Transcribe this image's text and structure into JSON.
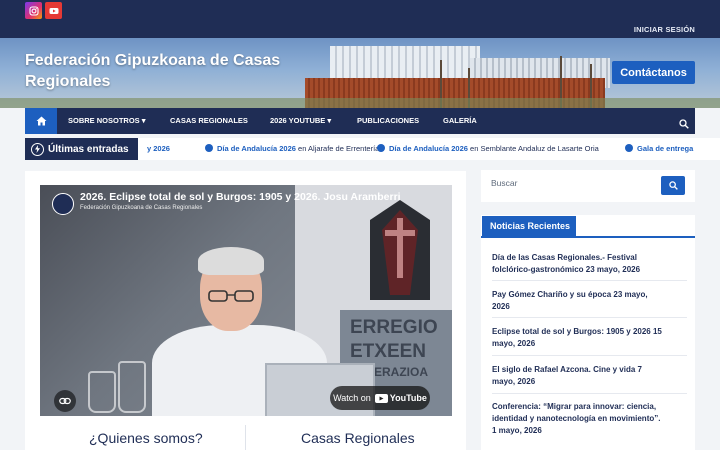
{
  "topbar": {
    "social": [
      {
        "icon": "instagram-icon"
      },
      {
        "icon": "youtube-icon"
      }
    ],
    "login_label": "INICIAR SESIÓN"
  },
  "header": {
    "site_title_line1": "Federación Gipuzkoana de Casas",
    "site_title_line2": "Regionales",
    "contact_button": "Contáctanos"
  },
  "nav": {
    "home_icon": "home-icon",
    "items": [
      {
        "label": "SOBRE NOSOTROS ▾"
      },
      {
        "label": "CASAS REGIONALES"
      },
      {
        "label": "2026 YOUTUBE ▾"
      },
      {
        "label": "PUBLICACIONES"
      },
      {
        "label": "GALERÍA"
      }
    ],
    "search_icon": "search-icon"
  },
  "ticker": {
    "label": "Últimas entradas",
    "items": [
      {
        "text": "y 2026"
      },
      {
        "bold": "Día de Andalucía 2026",
        "text": " en Aljarafe de Errentería"
      },
      {
        "bold": "Día de Andalucía 2026",
        "text": " en Semblante Andaluz de Lasarte Oria"
      },
      {
        "bold": "Gala de entrega",
        "text": ""
      }
    ]
  },
  "video": {
    "title": "2026. Eclipse total de sol y Burgos: 1905 y 2026. Josu Aramberri",
    "channel": "Federación Gipuzkoana de Casas Regionales",
    "watch_on": "Watch on",
    "youtube": "YouTube",
    "wall_text_1": "ERREGIO",
    "wall_text_2": "ETXEEN",
    "wall_text_3": "FEDERAZIOA"
  },
  "main": {
    "col1_heading": "¿Quienes somos?",
    "col2_heading": "Casas Regionales"
  },
  "sidebar": {
    "search_placeholder": "Buscar",
    "news_heading": "Noticias Recientes",
    "news": [
      {
        "line1": "Día de las Casas Regionales.- Festival",
        "line2": "folclórico-gastronómico 23 mayo, 2026"
      },
      {
        "line1": "Pay Gómez Chariño y su época 23 mayo,",
        "line2": "2026"
      },
      {
        "line1": "Eclipse total de sol y Burgos: 1905 y 2026 15",
        "line2": "mayo, 2026"
      },
      {
        "line1": "El siglo de Rafael Azcona. Cine y vida 7",
        "line2": "mayo, 2026"
      },
      {
        "line1": "Conferencia: “Migrar para innovar: ciencia,",
        "line2": "identidad y nanotecnología en movimiento”.",
        "line3": "1 mayo, 2026"
      }
    ]
  },
  "colors": {
    "navy": "#1f2d55",
    "accent": "#1d5fbf"
  }
}
